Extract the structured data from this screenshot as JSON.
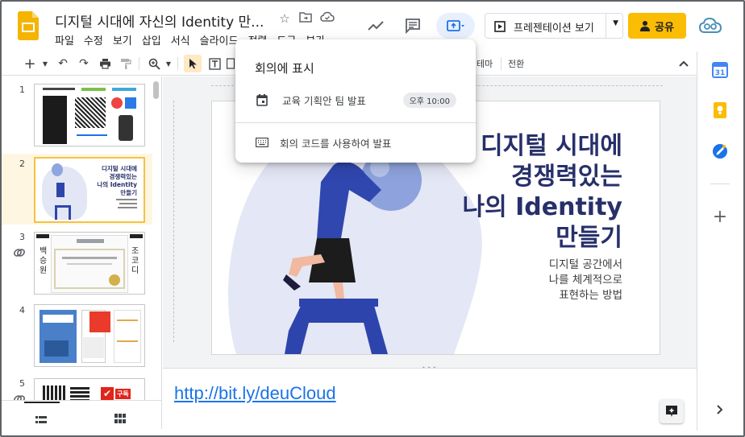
{
  "document": {
    "title": "디지털 시대에 자신의 Identity 만..."
  },
  "menu": [
    "파일",
    "수정",
    "보기",
    "삽입",
    "서식",
    "슬라이드",
    "정렬",
    "도구",
    "부가"
  ],
  "header": {
    "slideshow_label": "프레젠테이션 보기",
    "share_label": "공유"
  },
  "toolbar": {
    "theme_label": "테마",
    "transition_label": "전환"
  },
  "filmstrip": {
    "slides": [
      {
        "num": "1"
      },
      {
        "num": "2"
      },
      {
        "num": "3"
      },
      {
        "num": "4"
      },
      {
        "num": "5"
      }
    ],
    "slide2_text": {
      "l1": "디지털 시대에",
      "l2": "경쟁력있는",
      "l3": "나의 Identity",
      "l4": "만들기"
    },
    "slide3_left": "백승원",
    "slide3_right": "조코디",
    "slide5_badge": "구독"
  },
  "slide": {
    "line1": "디지털 시대에",
    "line2": "경쟁력있는",
    "line3": "나의 Identity",
    "line4": "만들기",
    "sub1": "디지털 공간에서",
    "sub2": "나를 체계적으로",
    "sub3": "표현하는 방법"
  },
  "notes": {
    "link": "http://bit.ly/deuCloud"
  },
  "present_menu": {
    "title": "회의에 표시",
    "items": [
      {
        "label": "교육 기획안 팀 발표",
        "time": "오후 10:00",
        "icon": "calendar-icon"
      },
      {
        "label": "회의 코드를 사용하여 발표",
        "icon": "keyboard-icon"
      }
    ]
  },
  "colors": {
    "accent_blue": "#1a73e8",
    "share_yellow": "#fbbc04",
    "slide_title": "#27306a",
    "active_thumb_border": "#f6c142"
  }
}
